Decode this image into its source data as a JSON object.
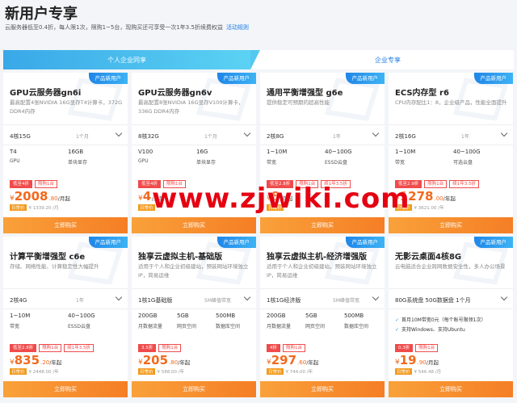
{
  "header": {
    "title": "新用户专享",
    "subtitle": "云服务器低至0.4折，每人限1次，限购1~5台，现购买还可享受一次1年3.5折续费权益",
    "rules_link": "活动规则"
  },
  "tabs": [
    "个人企业同享",
    "企业专享"
  ],
  "badge_label": "产品新用户",
  "buy_label": "立即购买",
  "watermark": "www.zjwiki.com",
  "cards": [
    {
      "title": "GPU云服务器gn6i",
      "desc": "最高配置4张NVIDIA 16G显存T4计算卡，372G DDR4内存",
      "config": "4核15G",
      "duration": "1个月",
      "specs": [
        {
          "v": "T4",
          "l": "GPU"
        },
        {
          "v": "16GB",
          "l": "单块显存"
        }
      ],
      "tags": [
        "低至4折",
        "限购1台"
      ],
      "price_int": "2008",
      "price_dec": ".80",
      "unit": "/月起",
      "orig_badge": "日常价",
      "orig": "¥ 1339.20 /月"
    },
    {
      "title": "GPU云服务器gn6v",
      "desc": "最高配置8张NVIDIA 16G显存V100计算卡，336G DDR4内存",
      "config": "8核32G",
      "duration": "1个月",
      "specs": [
        {
          "v": "V100",
          "l": "GPU"
        },
        {
          "v": "16G",
          "l": "单块显存"
        }
      ],
      "tags": [
        "低至4折",
        "限购1台"
      ],
      "price_int": "4",
      "price_dec": "",
      "unit": "/月起",
      "orig_badge": "日常价",
      "orig": ""
    },
    {
      "title": "通用平衡增强型 g6e",
      "desc": "提供稳定可预期的超高性能",
      "config": "2核8G",
      "duration": "1年",
      "specs": [
        {
          "v": "1~10M",
          "l": "带宽"
        },
        {
          "v": "40~100G",
          "l": "ESSD云盘"
        }
      ],
      "tags": [
        "低至2.8折",
        "限购1台",
        "续1年3.5折"
      ],
      "price_int": "8",
      "price_dec": "",
      "unit": "/月起",
      "orig_badge": "日常价",
      "orig": ""
    },
    {
      "title": "ECS内存型 r6",
      "desc": "CPU内存配比1：8，企业级产品，性能全面提升",
      "config": "2核16G",
      "duration": "1年",
      "specs": [
        {
          "v": "1~10M",
          "l": "带宽"
        },
        {
          "v": "40~100G",
          "l": "可选云盘"
        }
      ],
      "tags": [
        "低至2.9折",
        "限购1台",
        "续1年3.5折"
      ],
      "price_int": "1278",
      "price_dec": ".00",
      "unit": "/年起",
      "orig_badge": "日常价",
      "orig": "¥ 3621.00 /年"
    },
    {
      "title": "计算平衡增强型 c6e",
      "desc": "存储、网络性能、计算稳定性大幅提升",
      "config": "2核4G",
      "duration": "1年",
      "specs": [
        {
          "v": "1~10M",
          "l": "带宽"
        },
        {
          "v": "40~100G",
          "l": "ESSD云盘"
        }
      ],
      "tags": [
        "低至2.8折",
        "限购1台",
        "续1年3.5折"
      ],
      "price_int": "835",
      "price_dec": ".20",
      "unit": "/年起",
      "orig_badge": "日常价",
      "orig": "¥ 2448.00 /年"
    },
    {
      "title": "独享云虚拟主机-基础版",
      "desc": "适用于个人和企业初级建站，预装网站环境独立IP，简易运维",
      "config": "1核1G基础版",
      "duration": "5M峰值带宽",
      "specs": [
        {
          "v": "200GB",
          "l": "月数据流量"
        },
        {
          "v": "5GB",
          "l": "网页空间"
        },
        {
          "v": "500MB",
          "l": "数据库空间"
        }
      ],
      "tags": [
        "3.5折",
        "限购1台"
      ],
      "price_int": "205",
      "price_dec": ".80",
      "unit": "/年起",
      "orig_badge": "日常价",
      "orig": "¥ 588.00 /年"
    },
    {
      "title": "独享云虚拟主机-经济增强版",
      "desc": "适用于个人和企业初级建站，预装网站环境独立IP，简易运维",
      "config": "1核1G经济版",
      "duration": "5M峰值带宽",
      "specs": [
        {
          "v": "200GB",
          "l": "月数据流量"
        },
        {
          "v": "5GB",
          "l": "网页空间"
        },
        {
          "v": "500MB",
          "l": "数据库空间"
        }
      ],
      "tags": [
        "4折",
        "限购1台"
      ],
      "price_int": "297",
      "price_dec": ".60",
      "unit": "/年起",
      "orig_badge": "日常价",
      "orig": "¥ 744.00 /年"
    },
    {
      "title": "无影云桌面4核8G",
      "desc": "云电脑适合企业跨网数据安全性，多人办公场景",
      "config": "80G系统盘 50G数据盘 1个月",
      "duration": "",
      "features": [
        "首月10M带宽0元（每个账号限领1次）",
        "支持Windows、支持Ubuntu"
      ],
      "tags": [
        "0.3折",
        "限购1台"
      ],
      "price_int": "19",
      "price_dec": ".90",
      "unit": "/月起",
      "orig_badge": "日常价",
      "orig": "¥ 546.48 /月"
    }
  ]
}
